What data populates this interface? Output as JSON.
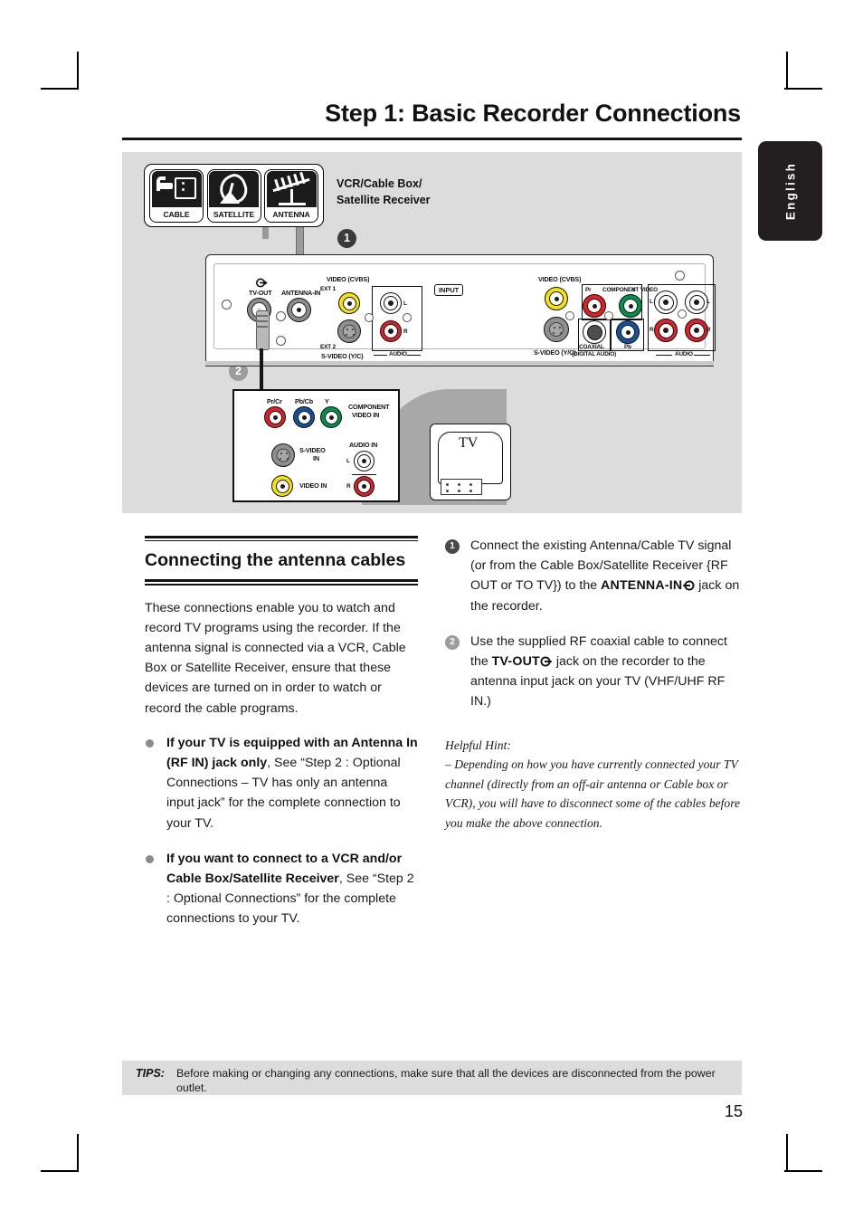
{
  "header": {
    "title": "Step 1: Basic Recorder Connections",
    "language_tab": "English"
  },
  "diagram": {
    "source_icons": [
      {
        "caption": "CABLE",
        "icon": "cable-plug-icon"
      },
      {
        "caption": "SATELLITE",
        "icon": "satellite-dish-icon"
      },
      {
        "caption": "ANTENNA",
        "icon": "roof-antenna-icon"
      }
    ],
    "source_label_line1": "VCR/Cable Box/",
    "source_label_line2": "Satellite Receiver",
    "markers": {
      "one": "1",
      "two": "2"
    },
    "recorder_left_panel": {
      "tv_out": "TV-OUT",
      "antenna_in": "ANTENNA-IN",
      "video_cvbs": "VIDEO (CVBS)",
      "ext1": "EXT 1",
      "ext2": "EXT 2",
      "svideo": "S-VIDEO (Y/C)",
      "input_badge": "INPUT",
      "audio": "AUDIO",
      "audio_l": "L",
      "audio_r": "R"
    },
    "recorder_right_panel": {
      "video_cvbs": "VIDEO (CVBS)",
      "svideo": "S-VIDEO (Y/C)",
      "component_video": "COMPONENT VIDEO",
      "pr": "Pr",
      "pb": "Pb",
      "y": "Y",
      "coaxial_line1": "COAXIAL",
      "coaxial_line2": "(DIGITAL AUDIO)",
      "audio": "AUDIO",
      "audio_l": "L",
      "audio_r": "R"
    },
    "tv_panel": {
      "pr_cr": "Pr/Cr",
      "pb_cb": "Pb/Cb",
      "y": "Y",
      "component_line1": "COMPONENT",
      "component_line2": "VIDEO IN",
      "svideo_line1": "S-VIDEO",
      "svideo_line2": "IN",
      "video_in": "VIDEO IN",
      "audio_in": "AUDIO IN",
      "audio_l": "L",
      "audio_r": "R"
    },
    "tv_label": "TV"
  },
  "left_column": {
    "heading": "Connecting the antenna cables",
    "intro": "These connections enable you to watch and record TV programs using the recorder. If the antenna signal is connected via a VCR, Cable Box or Satellite Receiver, ensure that these devices are turned on in order to watch or record the cable programs.",
    "bullets": [
      {
        "bold": "If your TV is equipped with an Antenna In (RF IN) jack only",
        "rest": ", See “Step 2 : Optional Connections – TV has only an antenna input jack” for the complete connection to your TV."
      },
      {
        "bold": "If you want to connect to a VCR and/or Cable Box/Satellite Receiver",
        "rest": ", See “Step 2 : Optional Connections” for the complete connections to your TV."
      }
    ]
  },
  "right_column": {
    "steps": [
      {
        "number": "1",
        "text_before": "Connect the existing Antenna/Cable TV signal (or from the Cable Box/Satellite Receiver {RF OUT or TO TV}) to the ",
        "bold": "ANTENNA-IN",
        "text_after": " jack on the recorder."
      },
      {
        "number": "2",
        "text_before": "Use the supplied RF coaxial cable to connect the ",
        "bold": "TV-OUT",
        "text_after": " jack on the recorder to the antenna input jack on your TV (VHF/UHF RF IN.)"
      }
    ],
    "hint_title": "Helpful Hint:",
    "hint_body": "– Depending on how you have currently connected your TV channel (directly from an off-air antenna or Cable box or VCR), you will have to disconnect some of the cables before you make the above connection."
  },
  "footer": {
    "tips_label": "TIPS:",
    "tips_text": "Before making or changing any connections, make sure that all the devices are disconnected from the power outlet.",
    "page_number": "15"
  },
  "colors": {
    "panel_gray": "#dcdcdc",
    "accent_black": "#231f20",
    "jack_yellow": "#f7e400",
    "jack_red": "#e21f26",
    "jack_green": "#00924a",
    "jack_blue": "#1452a0",
    "jack_gray": "#8b8b8b"
  }
}
